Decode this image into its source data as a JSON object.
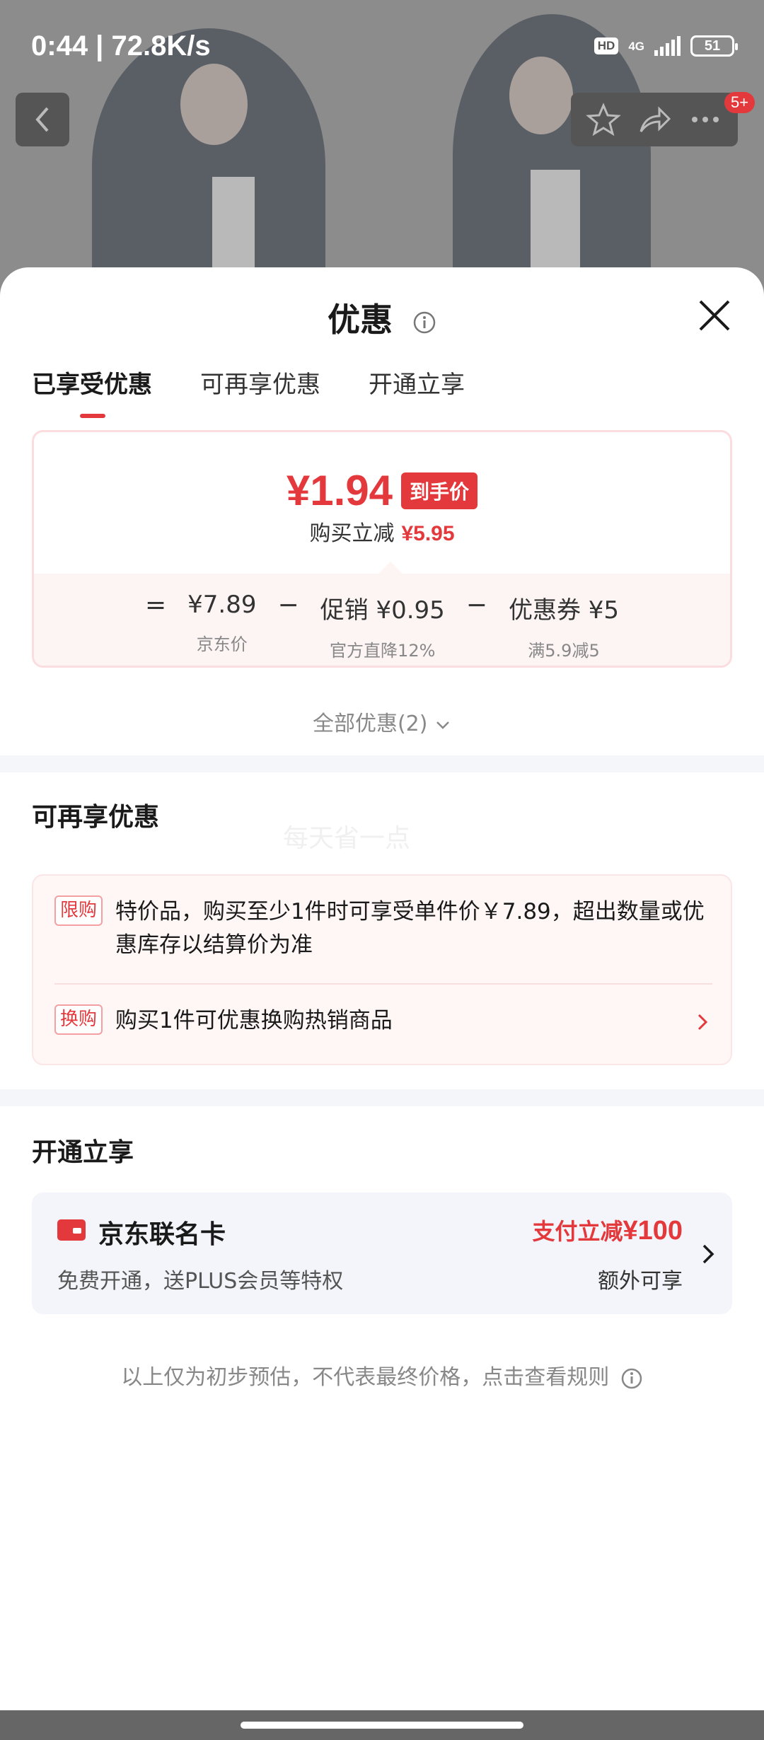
{
  "status_bar": {
    "time_speed": "0:44 | 72.8K/s",
    "hd": "HD",
    "network": "4G",
    "battery": "51"
  },
  "top_actions": {
    "badge": "5+"
  },
  "sheet": {
    "title": "优惠",
    "tabs": [
      "已享受优惠",
      "可再享优惠",
      "开通立享"
    ]
  },
  "price_card": {
    "final_price": "¥1.94",
    "final_tag": "到手价",
    "save_label": "购买立减",
    "save_amount": "¥5.95",
    "formula": {
      "eq": "=",
      "jd_price": "¥7.89",
      "jd_price_label": "京东价",
      "minus1": "−",
      "promo": "促销 ¥0.95",
      "promo_label": "官方直降12%",
      "minus2": "−",
      "coupon": "优惠券 ¥5",
      "coupon_label": "满5.9减5"
    }
  },
  "all_promos": "全部优惠(2)",
  "more_section": {
    "title": "可再享优惠",
    "watermark": "每天省一点",
    "items": [
      {
        "tag": "限购",
        "text": "特价品，购买至少1件时可享受单件价￥7.89，超出数量或优惠库存以结算价为准"
      },
      {
        "tag": "换购",
        "text": "购买1件可优惠换购热销商品"
      }
    ]
  },
  "open_section": {
    "title": "开通立享",
    "card_name": "京东联名卡",
    "card_desc": "免费开通，送PLUS会员等特权",
    "benefit_prefix": "支付立减",
    "benefit_amount": "¥100",
    "benefit_extra": "额外可享"
  },
  "disclaimer": "以上仅为初步预估，不代表最终价格，点击查看规则",
  "colors": {
    "accent": "#e4393c",
    "card_bg": "#f4f5fa",
    "promo_bg": "#fff6f6"
  }
}
